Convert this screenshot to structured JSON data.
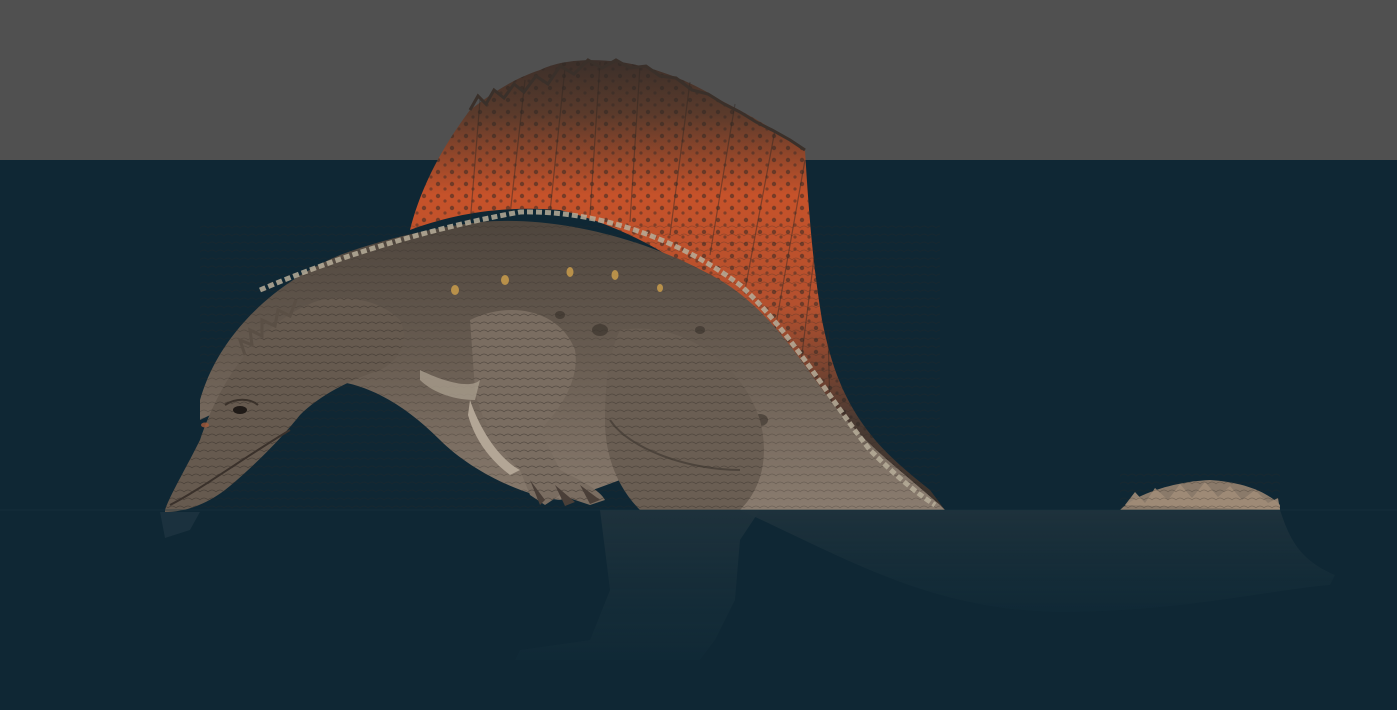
{
  "scene": {
    "subject": "spinosaurus",
    "colors": {
      "sky": "#505050",
      "water": "#0f2734",
      "skin": "#5b5047",
      "skin_dark": "#3a332d",
      "skin_light": "#8a7c70",
      "sail_orange": "#c6522a",
      "sail_dark": "#3b2f2a",
      "spine_stripe": "#b7ae9a",
      "belly": "#a89c8c",
      "spots": "#d1a24c"
    },
    "icons": [
      "dinosaur-figure",
      "water-reflection"
    ]
  }
}
